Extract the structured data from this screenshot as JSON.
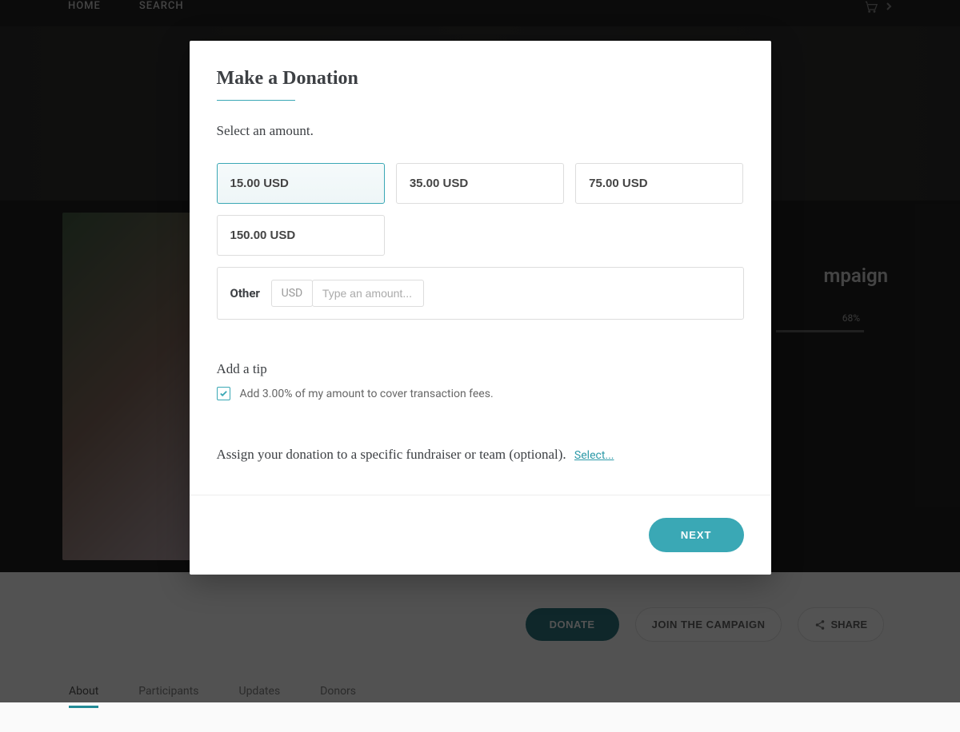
{
  "nav": {
    "home": "HOME",
    "search": "SEARCH"
  },
  "campaign": {
    "title_fragment": "mpaign",
    "progress_pct": "68%"
  },
  "actions": {
    "donate": "DONATE",
    "join": "JOIN THE CAMPAIGN",
    "share": "SHARE"
  },
  "tabs": {
    "about": "About",
    "participants": "Participants",
    "updates": "Updates",
    "donors": "Donors"
  },
  "modal": {
    "title": "Make a Donation",
    "select_amount": "Select an amount.",
    "amounts": {
      "0": "15.00 USD",
      "1": "35.00 USD",
      "2": "75.00 USD",
      "3": "150.00 USD"
    },
    "other_label": "Other",
    "currency": "USD",
    "amount_placeholder": "Type an amount...",
    "tip_header": "Add a tip",
    "tip_label": "Add 3.00% of my amount to cover transaction fees.",
    "assign_text": "Assign your donation to a specific fundraiser or team (optional).",
    "assign_link": "Select...",
    "next_button": "NEXT"
  },
  "colors": {
    "accent": "#3aa8b5",
    "dark_accent": "#1b6b75"
  }
}
